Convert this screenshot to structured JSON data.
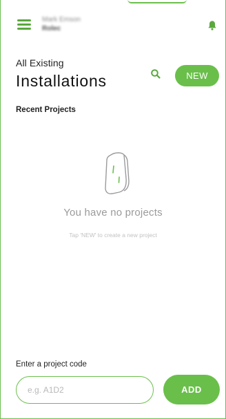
{
  "header": {
    "user_name": "Mark Emson",
    "company": "Rolec",
    "menu_icon": "hamburger-menu-icon",
    "bell_icon": "bell-icon"
  },
  "page": {
    "pre_title": "All Existing",
    "title": "Installations",
    "search_icon": "search-icon",
    "new_label": "NEW"
  },
  "recent": {
    "label": "Recent Projects"
  },
  "empty_state": {
    "illustration": "charger-icon",
    "title": "You have no projects",
    "subtitle": "Tap 'NEW' to create a new project"
  },
  "project_code": {
    "label": "Enter a project code",
    "placeholder": "e.g. A1D2",
    "value": "",
    "add_label": "ADD"
  },
  "colors": {
    "accent": "#6abf4b",
    "accent_dark": "#5aa83d"
  }
}
